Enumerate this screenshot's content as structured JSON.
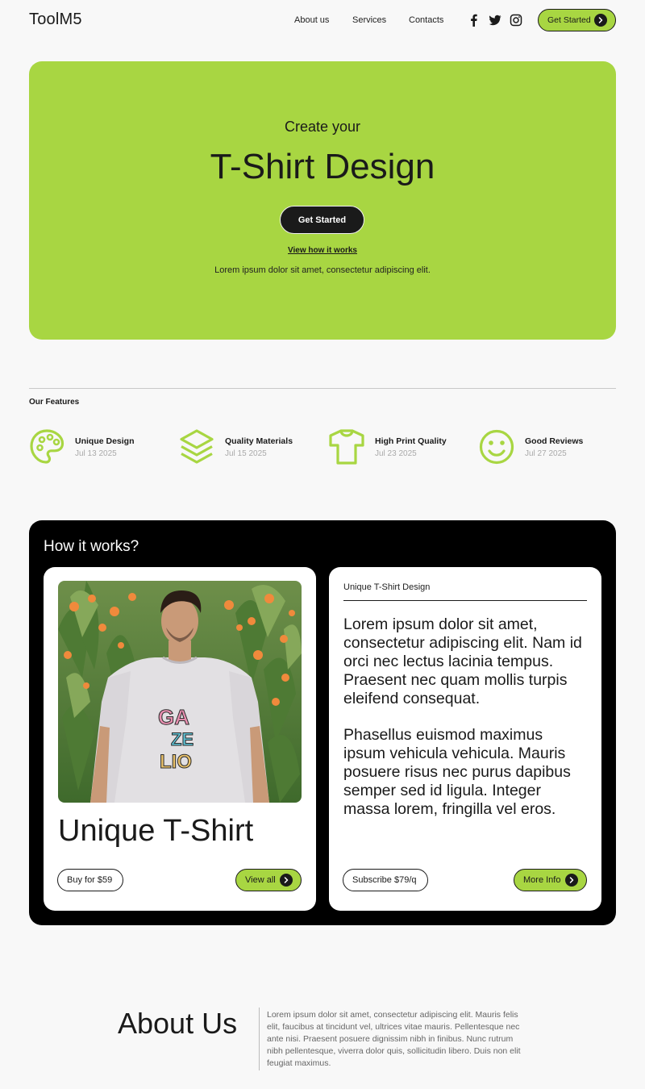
{
  "header": {
    "logo": "ToolM5",
    "nav": [
      "About us",
      "Services",
      "Contacts"
    ],
    "social_icons": [
      "facebook-icon",
      "twitter-icon",
      "instagram-icon"
    ],
    "cta_label": "Get Started"
  },
  "hero": {
    "subtitle": "Create your",
    "title": "T-Shirt Design",
    "button_label": "Get Started",
    "link_label": "View how it works",
    "description": "Lorem ipsum dolor sit amet, consectetur adipiscing elit."
  },
  "features": {
    "title": "Our Features",
    "items": [
      {
        "name": "Unique Design",
        "date": "Jul 13 2025",
        "icon": "palette-icon"
      },
      {
        "name": "Quality Materials",
        "date": "Jul 15 2025",
        "icon": "layers-icon"
      },
      {
        "name": "High Print Quality",
        "date": "Jul 23 2025",
        "icon": "tshirt-icon"
      },
      {
        "name": "Good Reviews",
        "date": "Jul 27 2025",
        "icon": "smiley-icon"
      }
    ]
  },
  "how": {
    "title": "How it works?",
    "left_card": {
      "photo_tshirt_text": [
        "GA",
        "ZE",
        "LIO"
      ],
      "title": "Unique T-Shirt",
      "buy_label": "Buy for $59",
      "view_label": "View all"
    },
    "right_card": {
      "label": "Unique T-Shirt Design",
      "paragraph1": "Lorem ipsum dolor sit amet, consectetur adipiscing elit. Nam id orci nec lectus lacinia tempus. Praesent nec quam mollis turpis eleifend consequat.",
      "paragraph2": "Phasellus euismod maximus ipsum vehicula vehicula. Mauris posuere risus nec purus dapibus semper sed id ligula. Integer massa lorem, fringilla vel eros.",
      "subscribe_label": "Subscribe $79/q",
      "more_label": "More Info"
    }
  },
  "about": {
    "title": "About Us",
    "text": "Lorem ipsum dolor sit amet, consectetur adipiscing elit. Mauris felis elit, faucibus at tincidunt vel, ultrices vitae mauris. Pellentesque nec ante nisi. Praesent posuere dignissim nibh in finibus. Nunc rutrum nibh pellentesque, viverra dolor quis, sollicitudin libero. Duis non elit feugiat maximus."
  },
  "colors": {
    "accent": "#a8d642",
    "dark": "#1a1a1a",
    "page_bg": "#f8f8f8"
  }
}
